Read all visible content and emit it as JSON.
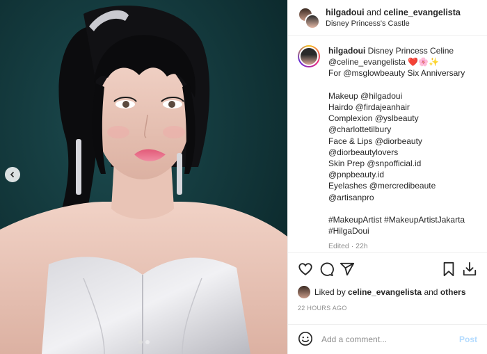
{
  "post": {
    "header": {
      "author": "hilgadoui",
      "joiner": "and",
      "collaborator": "celine_evangelista",
      "location": "Disney Princess's Castle"
    },
    "caption": {
      "username": "hilgadoui",
      "line1_text": "Disney Princess Celine",
      "line2_text": "@celine_evangelista",
      "line2_emoji": "❤️🌸✨",
      "line3": "For @msglowbeauty Six Anniversary",
      "credits": [
        "Makeup @hilgadoui",
        "Hairdo @firdajeanhair",
        "Complexion @yslbeauty",
        "@charlottetilbury",
        "Face & Lips @diorbeauty",
        "@diorbeautylovers",
        "Skin Prep @snpofficial.id",
        "@pnpbeauty.id",
        "Eyelashes @mercredibeaute",
        "@artisanpro"
      ],
      "hashtags_line1": "#MakeupArtist #MakeupArtistJakarta",
      "hashtags_line2": "#HilgaDoui",
      "edited": "Edited · 22h"
    },
    "likes": {
      "prefix": "Liked by",
      "user": "celine_evangelista",
      "joiner": "and",
      "others": "others"
    },
    "timestamp": "22 HOURS AGO",
    "comment": {
      "placeholder": "Add a comment...",
      "post_label": "Post"
    },
    "carousel": {
      "count": 2,
      "active_index": 0
    },
    "icons": [
      "heart-icon",
      "comment-icon",
      "share-icon",
      "bookmark-icon",
      "download-icon",
      "emoji-icon",
      "chevron-left-icon"
    ],
    "colors": {
      "link": "#00376b",
      "muted": "#8e8e8e",
      "post_disabled": "#b3dbff",
      "background_teal": "#0f3336"
    }
  }
}
